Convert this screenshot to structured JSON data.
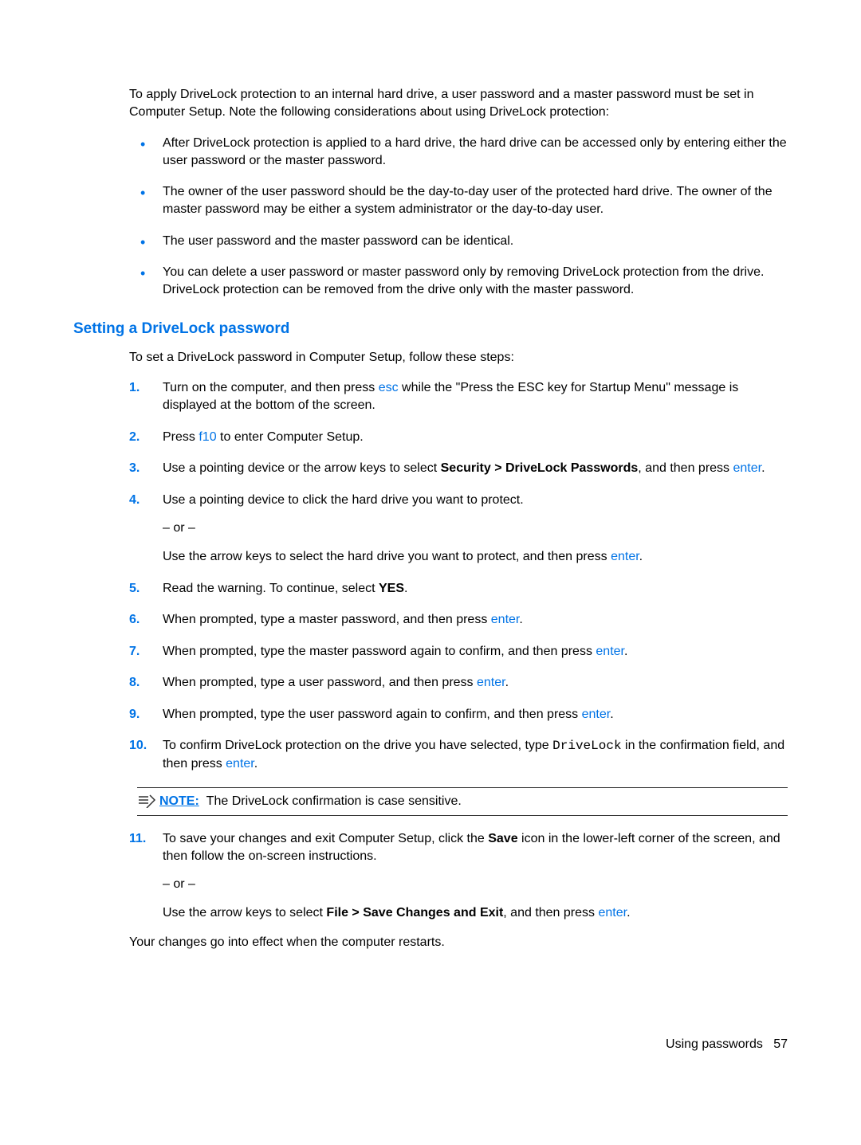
{
  "intro": "To apply DriveLock protection to an internal hard drive, a user password and a master password must be set in Computer Setup. Note the following considerations about using DriveLock protection:",
  "bullets": [
    "After DriveLock protection is applied to a hard drive, the hard drive can be accessed only by entering either the user password or the master password.",
    "The owner of the user password should be the day-to-day user of the protected hard drive. The owner of the master password may be either a system administrator or the day-to-day user.",
    "The user password and the master password can be identical.",
    "You can delete a user password or master password only by removing DriveLock protection from the drive. DriveLock protection can be removed from the drive only with the master password."
  ],
  "heading": "Setting a DriveLock password",
  "section_intro": "To set a DriveLock password in Computer Setup, follow these steps:",
  "steps": {
    "s1": {
      "num": "1.",
      "pre": "Turn on the computer, and then press ",
      "key": "esc",
      "post": " while the \"Press the ESC key for Startup Menu\" message is displayed at the bottom of the screen."
    },
    "s2": {
      "num": "2.",
      "pre": "Press ",
      "key": "f10",
      "post": " to enter Computer Setup."
    },
    "s3": {
      "num": "3.",
      "pre": "Use a pointing device or the arrow keys to select ",
      "bold": "Security > DriveLock Passwords",
      "mid": ", and then press ",
      "key": "enter",
      "post": "."
    },
    "s4": {
      "num": "4.",
      "text": "Use a pointing device to click the hard drive you want to protect.",
      "or": "– or –",
      "alt_pre": "Use the arrow keys to select the hard drive you want to protect, and then press ",
      "key": "enter",
      "alt_post": "."
    },
    "s5": {
      "num": "5.",
      "pre": "Read the warning. To continue, select ",
      "bold": "YES",
      "post": "."
    },
    "s6": {
      "num": "6.",
      "pre": "When prompted, type a master password, and then press ",
      "key": "enter",
      "post": "."
    },
    "s7": {
      "num": "7.",
      "pre": "When prompted, type the master password again to confirm, and then press ",
      "key": "enter",
      "post": "."
    },
    "s8": {
      "num": "8.",
      "pre": "When prompted, type a user password, and then press ",
      "key": "enter",
      "post": "."
    },
    "s9": {
      "num": "9.",
      "pre": "When prompted, type the user password again to confirm, and then press ",
      "key": "enter",
      "post": "."
    },
    "s10": {
      "num": "10.",
      "pre": "To confirm DriveLock protection on the drive you have selected, type ",
      "mono": "DriveLock",
      "mid": " in the confirmation field, and then press ",
      "key": "enter",
      "post": "."
    },
    "note_label": "NOTE:",
    "note_text": "The DriveLock confirmation is case sensitive.",
    "s11": {
      "num": "11.",
      "pre": "To save your changes and exit Computer Setup, click the ",
      "bold": "Save",
      "post": " icon in the lower-left corner of the screen, and then follow the on-screen instructions.",
      "or": "– or –",
      "alt_pre": "Use the arrow keys to select ",
      "alt_bold": "File > Save Changes and Exit",
      "alt_mid": ", and then press ",
      "key": "enter",
      "alt_post": "."
    }
  },
  "closing": "Your changes go into effect when the computer restarts.",
  "footer": {
    "label": "Using passwords",
    "page": "57"
  }
}
